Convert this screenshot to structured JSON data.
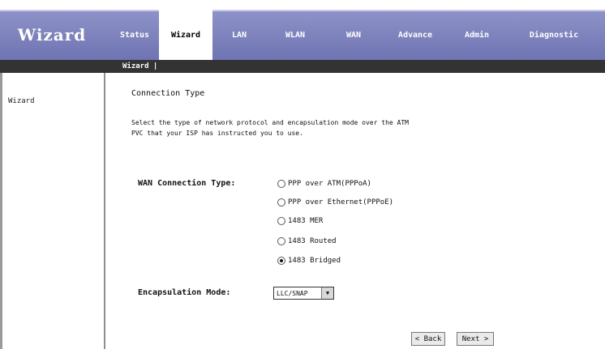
{
  "header": {
    "brand": "Wizard",
    "tabs": [
      {
        "label": "Status"
      },
      {
        "label": "Wizard"
      },
      {
        "label": "LAN"
      },
      {
        "label": "WLAN"
      },
      {
        "label": "WAN"
      },
      {
        "label": "Advance"
      },
      {
        "label": "Admin"
      },
      {
        "label": "Diagnostic"
      }
    ],
    "active_tab": "Wizard"
  },
  "subnav": {
    "items": [
      {
        "label": "Wizard |"
      }
    ]
  },
  "sidebar": {
    "items": [
      {
        "label": "Wizard"
      }
    ]
  },
  "main": {
    "title": "Connection Type",
    "description_line1": "Select the type of network protocol and encapsulation mode over the ATM",
    "description_line2": "PVC that your ISP has instructed you to use.",
    "wan_type_label": "WAN Connection Type:",
    "wan_options": [
      {
        "label": "PPP over ATM(PPPoA)",
        "checked": false
      },
      {
        "label": "PPP over Ethernet(PPPoE)",
        "checked": false
      },
      {
        "label": "1483 MER",
        "checked": false
      },
      {
        "label": "1483 Routed",
        "checked": false
      },
      {
        "label": "1483 Bridged",
        "checked": true
      }
    ],
    "encapsulation_label": "Encapsulation Mode:",
    "encapsulation_value": "LLC/SNAP",
    "back_button": "< Back",
    "next_button": "Next >"
  }
}
